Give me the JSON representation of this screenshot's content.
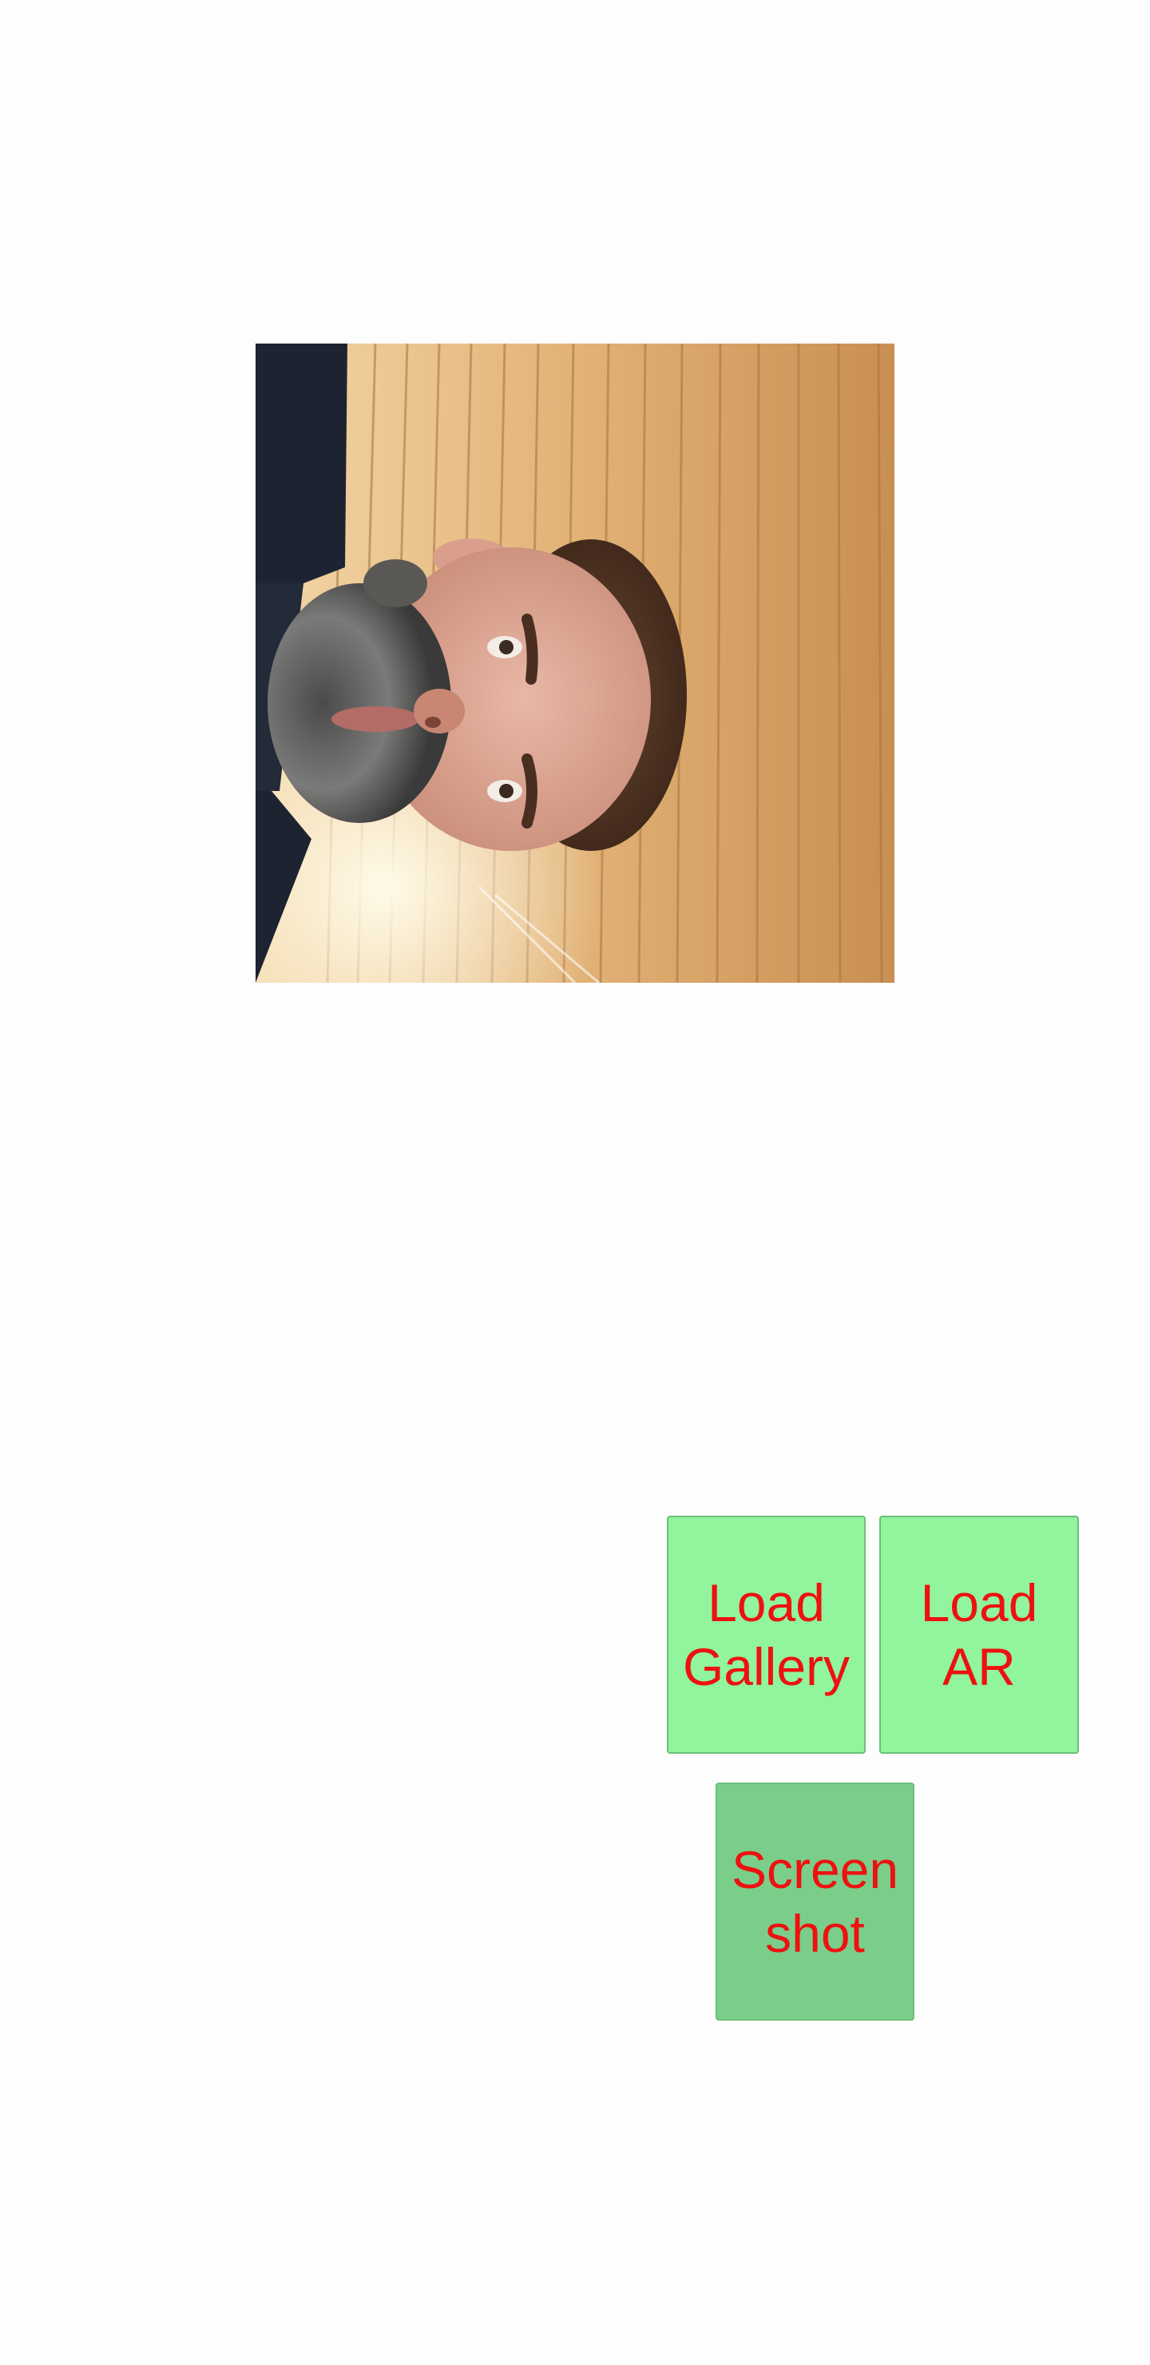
{
  "photo": {
    "alt": "rotated selfie photo of a bearded man"
  },
  "buttons": {
    "load_gallery": {
      "label": "Load\nGallery"
    },
    "load_ar": {
      "label": "Load\nAR"
    },
    "screenshot": {
      "label": "Screen\nshot"
    }
  },
  "colors": {
    "background": "#fdfdfd",
    "button_fill": "#90f59c",
    "button_fill_pressed": "#7ace8a",
    "button_text": "#ee1111",
    "button_border": "#6bbf7a"
  }
}
